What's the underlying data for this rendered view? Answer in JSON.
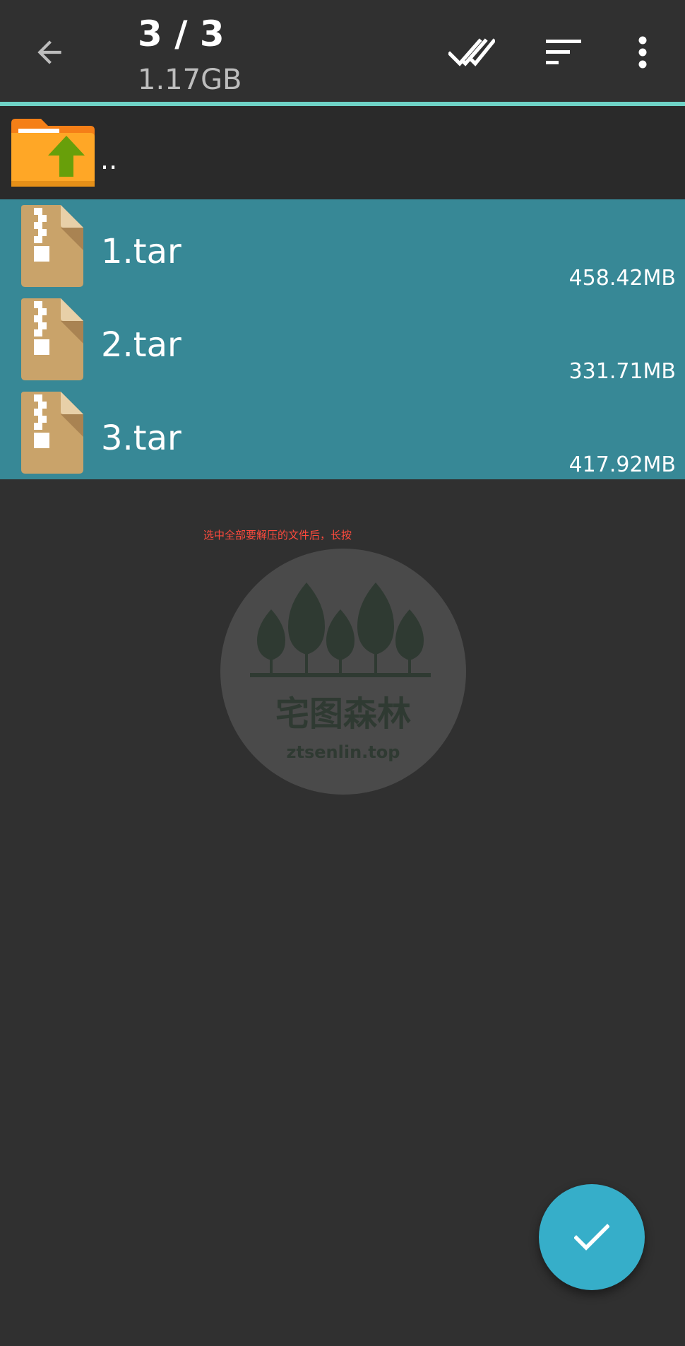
{
  "appbar": {
    "title": "3 / 3",
    "subtitle": "1.17GB",
    "back_icon": "arrow-back-icon",
    "select_all_icon": "double-check-icon",
    "sort_icon": "sort-icon",
    "more_icon": "more-vert-icon",
    "accent_color": "#6fd3c6"
  },
  "list": {
    "parent": {
      "label": "..",
      "icon": "folder-up-icon"
    },
    "files": [
      {
        "name": "1.tar",
        "size": "458.42MB",
        "icon": "archive-file-icon"
      },
      {
        "name": "2.tar",
        "size": "331.71MB",
        "icon": "archive-file-icon"
      },
      {
        "name": "3.tar",
        "size": "417.92MB",
        "icon": "archive-file-icon"
      }
    ],
    "selected_color": "#378896"
  },
  "overlay": {
    "hint": "选中全部要解压的文件后，长按",
    "watermark_name": "宅图森林",
    "watermark_url": "ztsenlin.top"
  },
  "fab": {
    "icon": "check-icon",
    "color": "#36aec9"
  }
}
